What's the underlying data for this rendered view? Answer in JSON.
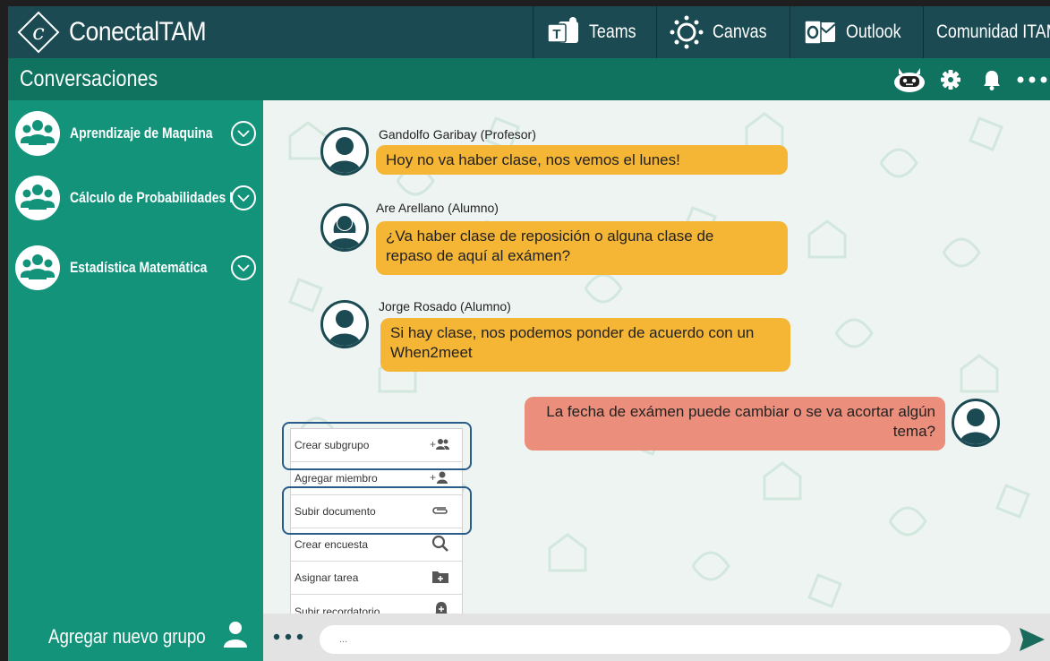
{
  "app": {
    "brand": "ConectalTAM",
    "logo_letter": "c"
  },
  "top_links": [
    {
      "label": "Teams",
      "icon": "teams-icon"
    },
    {
      "label": "Canvas",
      "icon": "canvas-icon"
    },
    {
      "label": "Outlook",
      "icon": "outlook-icon"
    },
    {
      "label": "Comunidad ITAM",
      "icon": ""
    }
  ],
  "header": {
    "title": "Conversaciones",
    "icons": [
      "bot-icon",
      "gear-icon",
      "bell-icon",
      "more-icon"
    ]
  },
  "sidebar": {
    "groups": [
      {
        "name": "Aprendizaje de Maquina"
      },
      {
        "name": "Cálculo de Probabilidades I"
      },
      {
        "name": "Estadística Matemática"
      }
    ],
    "add_group_label": "Agregar nuevo grupo"
  },
  "messages": [
    {
      "sender": "Gandolfo Garibay (Profesor)",
      "text": "Hoy no va haber clase, nos vemos el lunes!",
      "direction": "in",
      "avatar": "male-avatar-icon"
    },
    {
      "sender": "Are Arellano (Alumno)",
      "text_lines": [
        "¿Va haber clase de reposición o alguna clase  de",
        "repaso de aquí al exámen?"
      ],
      "direction": "in",
      "avatar": "female-avatar-icon"
    },
    {
      "sender": "Jorge Rosado (Alumno)",
      "text_lines": [
        "Si hay clase, nos podemos ponder de acuerdo con un",
        "When2meet"
      ],
      "direction": "in",
      "avatar": "male-avatar-icon"
    },
    {
      "sender": "",
      "text_lines": [
        "La fecha de exámen puede cambiar o se va acortar algún",
        "tema?"
      ],
      "direction": "out",
      "avatar": "male-avatar-icon"
    }
  ],
  "action_menu": {
    "items": [
      {
        "label": "Crear subgrupo",
        "icon": "add-group-icon"
      },
      {
        "label": "Agregar miembro",
        "icon": "add-person-icon"
      },
      {
        "label": "Subir documento",
        "icon": "paperclip-icon"
      },
      {
        "label": "Crear encuesta",
        "icon": "search-icon"
      },
      {
        "label": "Asignar tarea",
        "icon": "folder-plus-icon"
      },
      {
        "label": "Subir recordatorio",
        "icon": "bell-plus-icon"
      }
    ],
    "highlighted": [
      "Crear subgrupo",
      "Subir documento"
    ]
  },
  "composer": {
    "placeholder": "..."
  },
  "colors": {
    "topbar": "#1b4a52",
    "subbar": "#0f7360",
    "sidebar": "#12937a",
    "bubble_in": "#f5b535",
    "bubble_out": "#eb8f7c",
    "highlight_border": "#2a5c8a"
  }
}
